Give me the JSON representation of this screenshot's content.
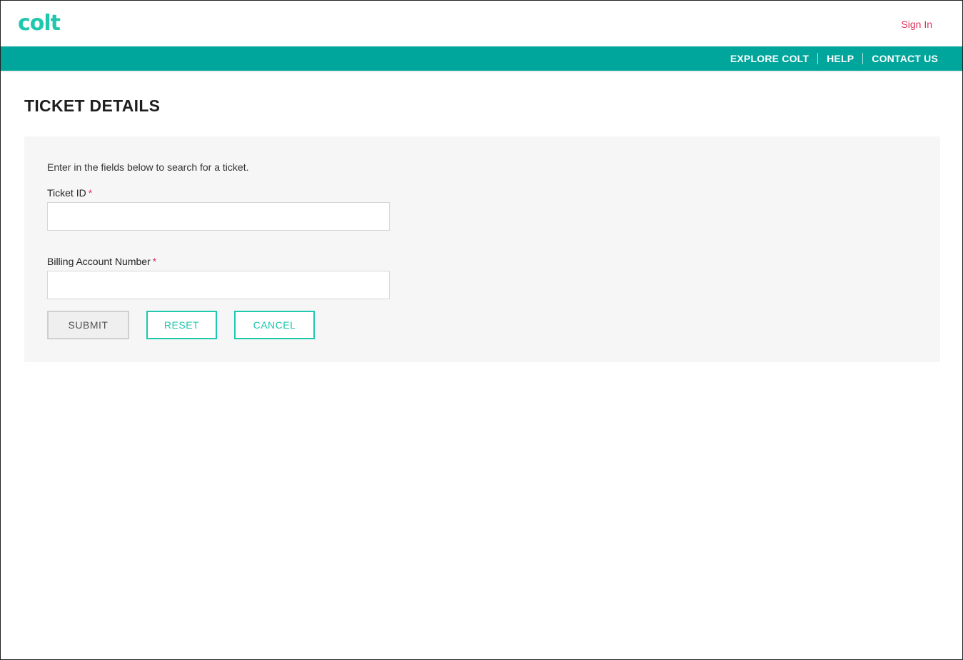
{
  "header": {
    "logo_text": "colt",
    "signin_label": "Sign In"
  },
  "nav": {
    "items": [
      {
        "label": "EXPLORE COLT"
      },
      {
        "label": "HELP"
      },
      {
        "label": "CONTACT US"
      }
    ]
  },
  "page": {
    "title": "TICKET DETAILS"
  },
  "form": {
    "intro": "Enter in the fields below to search for a ticket.",
    "required_marker": "*",
    "ticket_id": {
      "label": "Ticket ID",
      "value": ""
    },
    "billing_account": {
      "label": "Billing Account Number",
      "value": ""
    },
    "buttons": {
      "submit": "SUBMIT",
      "reset": "RESET",
      "cancel": "CANCEL"
    }
  },
  "colors": {
    "brand_teal": "#1fc8ad",
    "nav_bar": "#00a59b",
    "accent_pink": "#e0305d",
    "panel_bg": "#f6f6f6"
  }
}
